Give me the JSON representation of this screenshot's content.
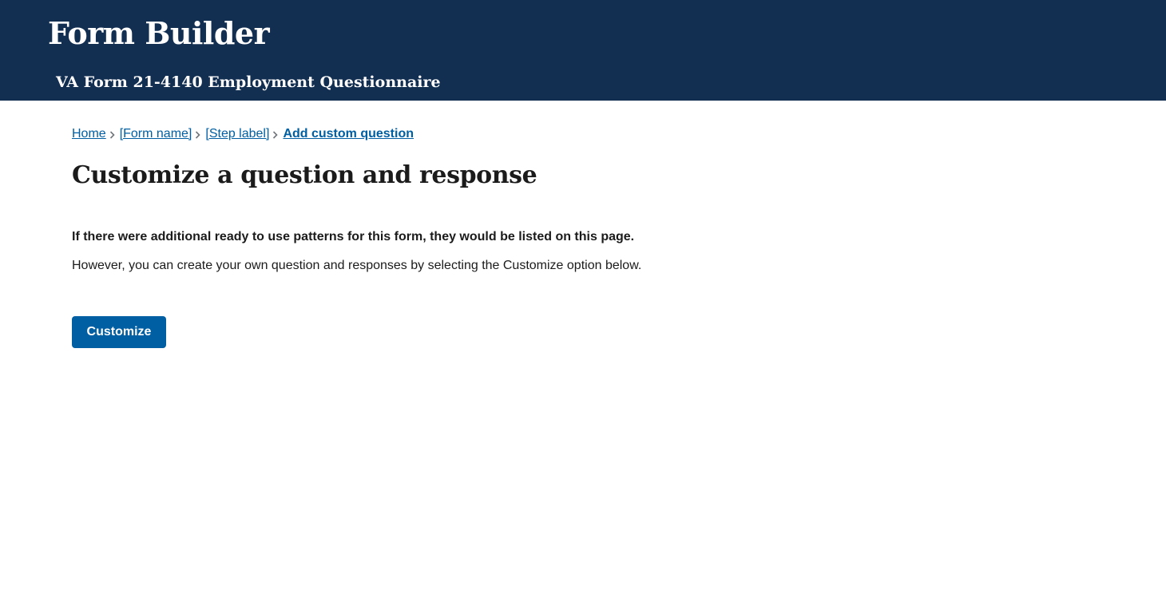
{
  "header": {
    "app_title": "Form Builder",
    "form_subtitle": "VA Form 21-4140 Employment Questionnaire",
    "background_color": "#122e51"
  },
  "breadcrumb": {
    "items": [
      {
        "label": "Home"
      },
      {
        "label": "[Form name]"
      },
      {
        "label": "[Step label]"
      },
      {
        "label": "Add custom question",
        "current": true
      }
    ],
    "separator_icon": "chevron-right-icon",
    "link_color": "#005ea2"
  },
  "main": {
    "title": "Customize a question and response",
    "intro_bold": "If there were additional ready to use patterns for this form, they would be listed on this page.",
    "intro_text": "However, you can create your own question and responses by selecting the Customize option below.",
    "customize_button_label": "Customize",
    "button_color": "#005ea2"
  }
}
